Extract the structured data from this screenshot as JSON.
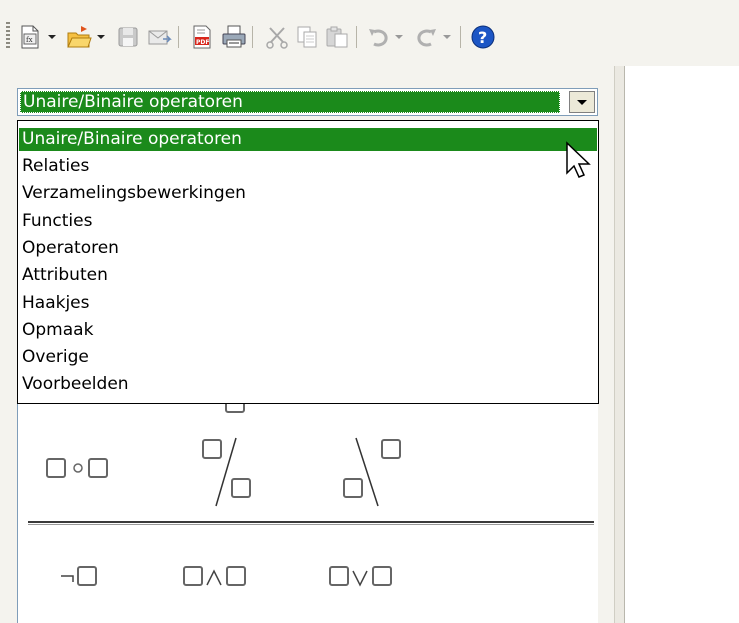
{
  "toolbar": {
    "buttons": [
      {
        "name": "formula-icon"
      },
      {
        "name": "open-folder-icon"
      },
      {
        "name": "save-icon"
      },
      {
        "name": "email-icon"
      },
      {
        "name": "export-pdf-icon"
      },
      {
        "name": "print-icon"
      },
      {
        "name": "cut-icon"
      },
      {
        "name": "copy-icon"
      },
      {
        "name": "paste-icon"
      },
      {
        "name": "undo-icon"
      },
      {
        "name": "redo-icon"
      },
      {
        "name": "help-icon"
      }
    ]
  },
  "category_select": {
    "selected": "Unaire/Binaire operatoren",
    "options": [
      "Unaire/Binaire operatoren",
      "Relaties",
      "Verzamelingsbewerkingen",
      "Functies",
      "Operatoren",
      "Attributen",
      "Haakjes",
      "Opmaak",
      "Overige",
      "Voorbeelden"
    ]
  },
  "symbols": [
    {
      "name": "circle-operator-symbol"
    },
    {
      "name": "division-slash-symbol"
    },
    {
      "name": "backslash-symbol"
    },
    {
      "name": "negation-symbol"
    },
    {
      "name": "logical-and-symbol"
    },
    {
      "name": "logical-or-symbol"
    }
  ],
  "colors": {
    "selection": "#1b8a1b",
    "toolbar_bg": "#f4f3ee",
    "help_blue": "#1c56c5"
  }
}
